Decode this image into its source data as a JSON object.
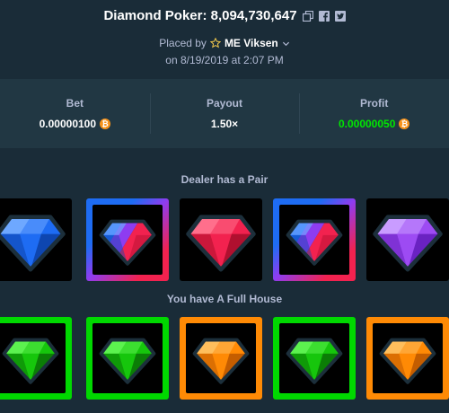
{
  "header": {
    "title": "Diamond Poker: 8,094,730,647",
    "placed_by_label": "Placed by",
    "username": "ME Viksen",
    "date": "on 8/19/2019 at 2:07 PM"
  },
  "stats": {
    "bet_label": "Bet",
    "bet_value": "0.00000100",
    "payout_label": "Payout",
    "payout_value": "1.50×",
    "profit_label": "Profit",
    "profit_value": "0.00000050",
    "currency_icon": "bitcoin-icon",
    "coin_glyph": "₿"
  },
  "dealer": {
    "title": "Dealer has a Pair",
    "cards": [
      {
        "gem": "blue",
        "highlight": "none"
      },
      {
        "gem": "split-blue-red",
        "highlight": "pair"
      },
      {
        "gem": "red",
        "highlight": "none"
      },
      {
        "gem": "split-blue-red",
        "highlight": "pair"
      },
      {
        "gem": "purple",
        "highlight": "none"
      }
    ]
  },
  "player": {
    "title": "You have A Full House",
    "cards": [
      {
        "gem": "green",
        "highlight": "green"
      },
      {
        "gem": "green",
        "highlight": "green"
      },
      {
        "gem": "orange",
        "highlight": "orange"
      },
      {
        "gem": "green",
        "highlight": "green"
      },
      {
        "gem": "orange",
        "highlight": "orange"
      }
    ]
  },
  "colors": {
    "background": "#1a2c38",
    "panel": "#213743",
    "profit_green": "#00e701",
    "gem_blue": "#1e6cf3",
    "gem_red": "#f2224f",
    "gem_purple": "#9d4bf3",
    "gem_green": "#16c60c",
    "gem_orange": "#ff8a05"
  }
}
